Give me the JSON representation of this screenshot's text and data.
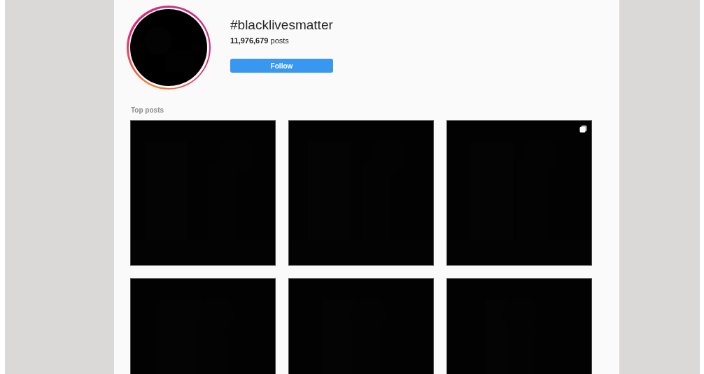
{
  "hashtag": {
    "title": "#blacklivesmatter",
    "post_count": "**11,976,679** posts",
    "follow_button": "Follow"
  },
  "top_posts": {
    "heading": "Top posts",
    "posts": [
      {
        "kind": "picture",
        "multiple": false
      },
      {
        "kind": "picture",
        "multiple": false
      },
      {
        "kind": "picture",
        "multiple": true
      },
      {
        "kind": "picture",
        "multiple": false
      },
      {
        "kind": "picture",
        "multiple": false
      },
      {
        "kind": "picture",
        "multiple": false
      }
    ]
  }
}
